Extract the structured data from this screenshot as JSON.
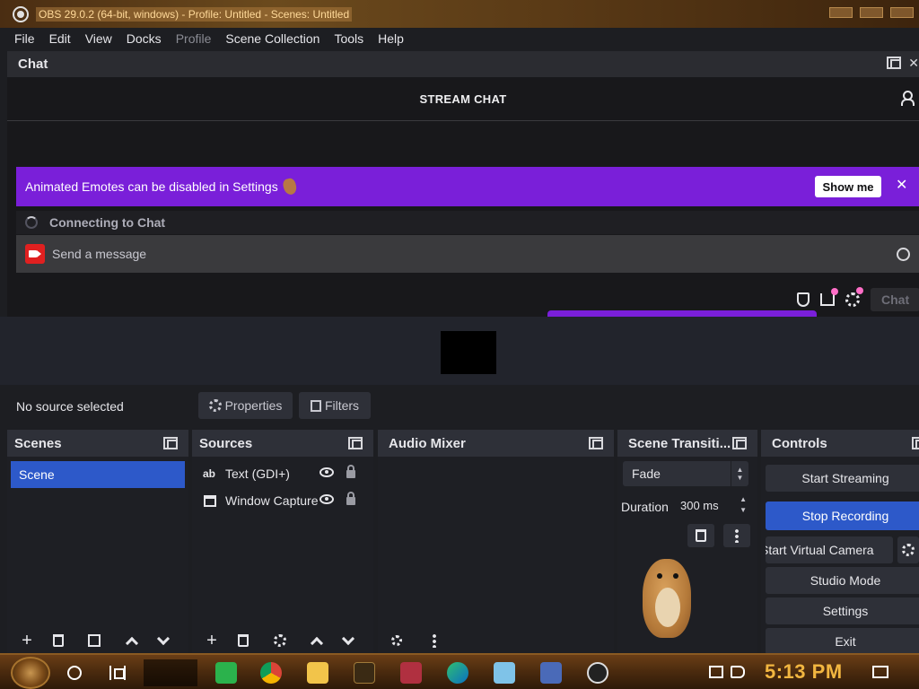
{
  "window": {
    "title": "OBS 29.0.2 (64-bit, windows) - Profile: Untitled - Scenes: Untitled"
  },
  "menu": [
    "File",
    "Edit",
    "View",
    "Docks",
    "Profile",
    "Scene Collection",
    "Tools",
    "Help"
  ],
  "chat_dock": {
    "title": "Chat",
    "header": "STREAM CHAT",
    "banner": {
      "text": "Animated Emotes can be disabled in Settings",
      "button": "Show me"
    },
    "status": "Connecting to Chat",
    "input_placeholder": "Send a message",
    "chat_button": "Chat"
  },
  "source_toolbar": {
    "no_source": "No source selected",
    "properties": "Properties",
    "filters": "Filters"
  },
  "docks": {
    "scenes": {
      "title": "Scenes",
      "items": [
        "Scene"
      ]
    },
    "sources": {
      "title": "Sources",
      "items": [
        {
          "label": "Text (GDI+)",
          "icon": "text-icon"
        },
        {
          "label": "Window Capture",
          "icon": "window-icon"
        }
      ]
    },
    "audio_mixer": {
      "title": "Audio Mixer"
    },
    "transitions": {
      "title": "Scene Transiti...",
      "selected": "Fade",
      "duration_label": "Duration",
      "duration_value": "300 ms"
    },
    "controls": {
      "title": "Controls",
      "buttons": [
        "Start Streaming",
        "Stop Recording",
        "Start Virtual Camera",
        "Studio Mode",
        "Settings",
        "Exit"
      ]
    }
  },
  "taskbar": {
    "clock": "5:13 PM"
  },
  "colors": {
    "accent_blue": "#2d59c9",
    "twitch_purple": "#7a1fd9",
    "clock_gold": "#f2b640"
  }
}
